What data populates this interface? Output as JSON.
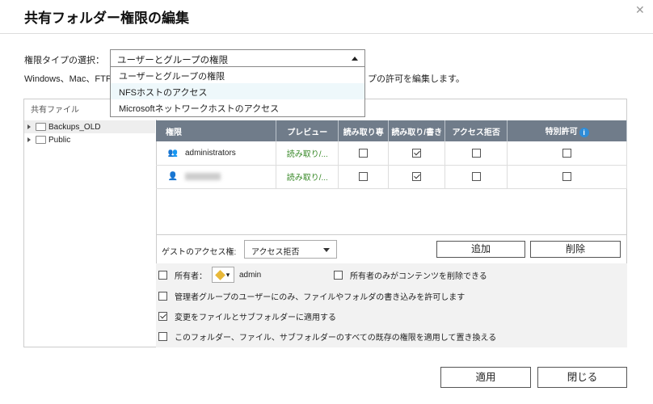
{
  "dialog": {
    "title": "共有フォルダー権限の編集",
    "close_icon": "close-icon"
  },
  "perm_type": {
    "label": "権限タイプの選択：",
    "selected": "ユーザーとグループの権限",
    "options": [
      "ユーザーとグループの権限",
      "NFSホストのアクセス",
      "Microsoftネットワークホストのアクセス"
    ]
  },
  "description": {
    "left": "Windows、Mac、FTP",
    "right": "プの許可を編集します。"
  },
  "tree": {
    "label": "共有ファイル",
    "items": [
      "Backups_OLD",
      "Public"
    ]
  },
  "table": {
    "headers": [
      "権限",
      "プレビュー",
      "読み取り専",
      "読み取り/書き",
      "アクセス拒否",
      "特別許可"
    ],
    "rows": [
      {
        "name": "administrators",
        "preview": "読み取り/...",
        "ro": false,
        "rw": true,
        "deny": false,
        "special": false,
        "icon": "group-icon"
      },
      {
        "name": "",
        "preview": "読み取り/...",
        "ro": false,
        "rw": true,
        "deny": false,
        "special": false,
        "icon": "user-icon"
      }
    ]
  },
  "guest": {
    "label": "ゲストのアクセス権:",
    "selected": "アクセス拒否"
  },
  "buttons": {
    "add": "追加",
    "delete": "削除",
    "apply": "適用",
    "close": "閉じる"
  },
  "options": {
    "owner_label": "所有者：",
    "owner_name": "admin",
    "owner_only_delete": "所有者のみがコンテンツを削除できる",
    "admin_group_only": "管理者グループのユーザーにのみ、ファイルやフォルダの書き込みを許可します",
    "apply_sub": "変更をファイルとサブフォルダーに適用する",
    "replace_all": "このフォルダー、ファイル、サブフォルダーのすべての既存の権限を適用して置き換える",
    "owner_checked": false,
    "owner_only_delete_checked": false,
    "admin_group_only_checked": false,
    "apply_sub_checked": true,
    "replace_all_checked": false
  },
  "colors": {
    "header_bg": "#707c8a",
    "preview_text": "#3a8a2a",
    "info_icon": "#2f8dd8",
    "dropdown_highlight": "#eef8fb"
  }
}
